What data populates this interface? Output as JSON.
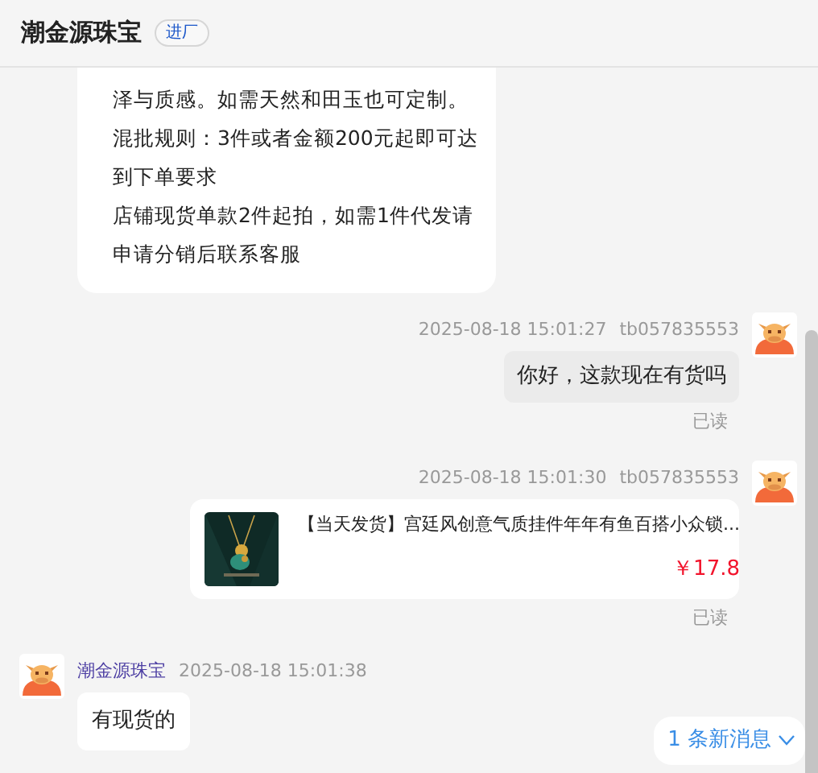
{
  "header": {
    "title": "潮金源珠宝",
    "tag": "进厂"
  },
  "messages": [
    {
      "kind": "long_text",
      "outgoing": false,
      "paragraphs": [
        "泽与质感。如需天然和田玉也可定制。",
        "混批规则：3件或者金额200元起即可达到下单要求",
        "店铺现货单款2件起拍，如需1件代发请申请分销后联系客服"
      ]
    },
    {
      "kind": "text",
      "outgoing": true,
      "time": "2025-08-18 15:01:27",
      "user": "tb057835553",
      "text": "你好，这款现在有货吗",
      "status": "已读"
    },
    {
      "kind": "product",
      "outgoing": true,
      "time": "2025-08-18 15:01:30",
      "user": "tb057835553",
      "title": "【当天发货】宫廷风创意气质挂件年年有鱼百搭小众锁...",
      "price": "￥17.8",
      "status": "已读"
    },
    {
      "kind": "text",
      "outgoing": false,
      "sender": "潮金源珠宝",
      "time": "2025-08-18 15:01:38",
      "text": "有现货的"
    }
  ],
  "new_messages": "1 条新消息"
}
